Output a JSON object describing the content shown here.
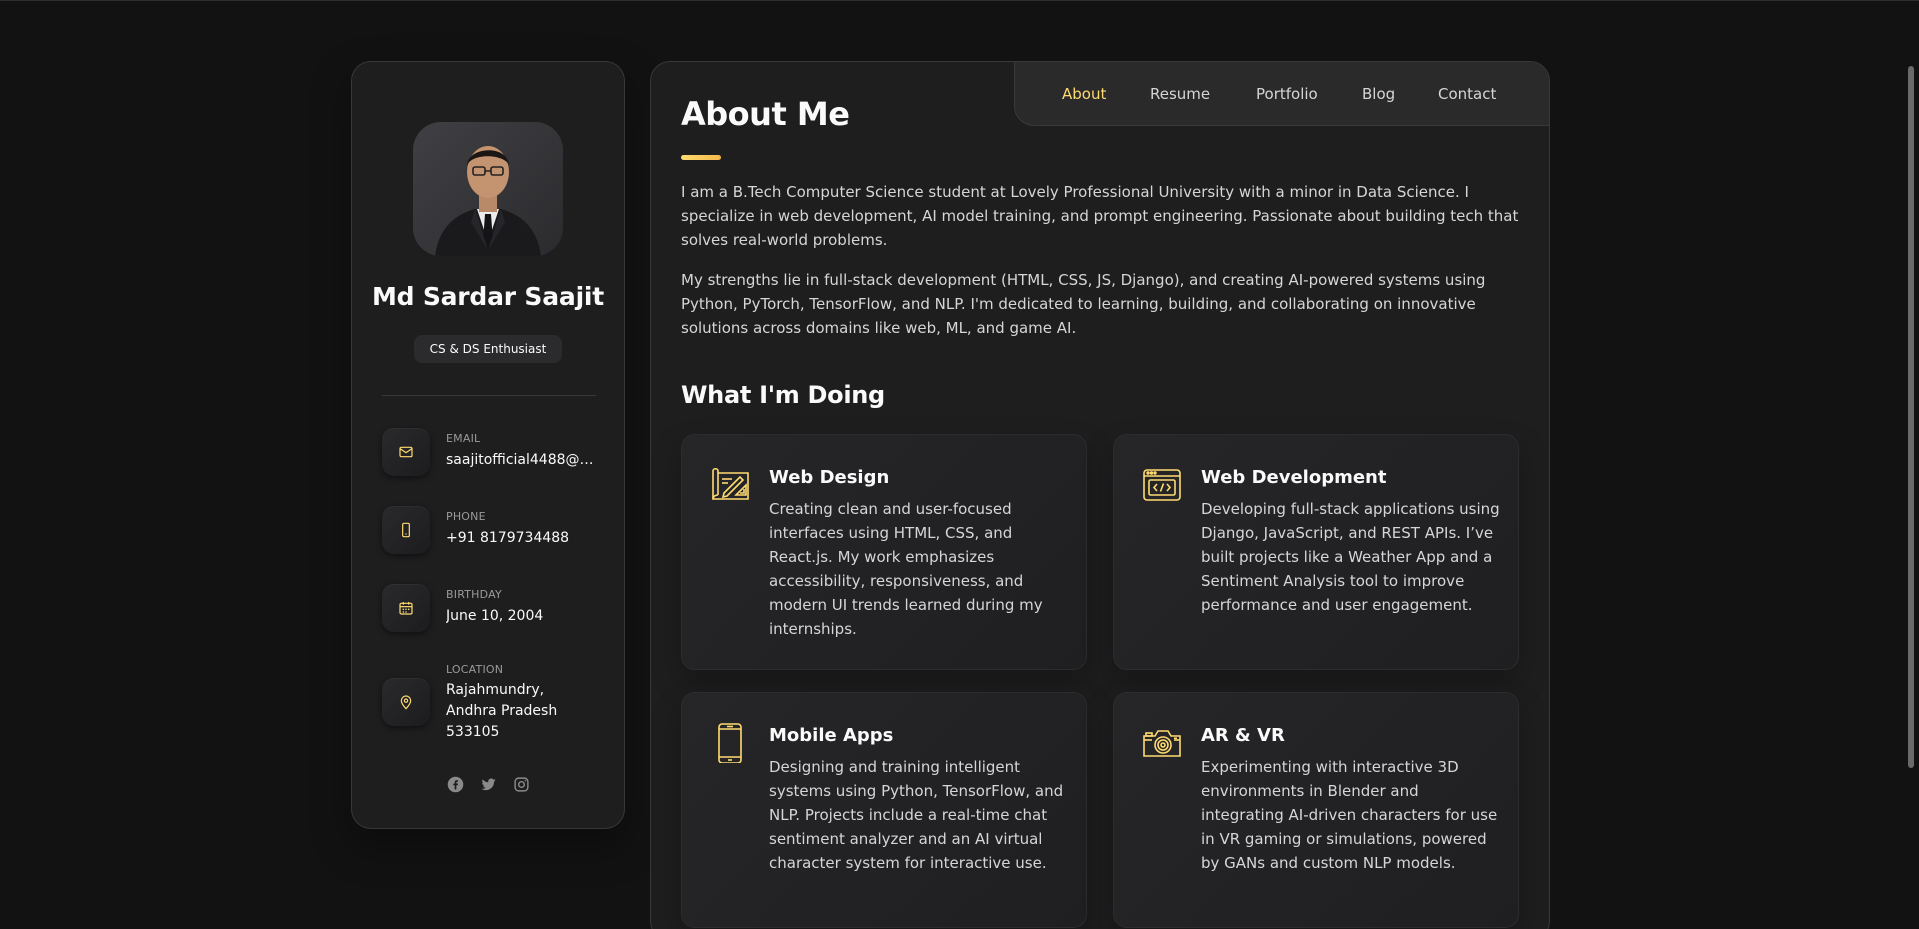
{
  "sidebar": {
    "name": "Md Sardar Saajit",
    "title": "CS & DS Enthusiast",
    "contacts": [
      {
        "label": "EMAIL",
        "value": "saajitofficial4488@g...",
        "icon": "mail-icon"
      },
      {
        "label": "PHONE",
        "value": "+91 8179734488",
        "icon": "phone-icon"
      },
      {
        "label": "BIRTHDAY",
        "value": "June 10, 2004",
        "icon": "calendar-icon"
      },
      {
        "label": "LOCATION",
        "value": "Rajahmundry, Andhra Pradesh 533105",
        "icon": "location-icon"
      }
    ],
    "socials": [
      "facebook-icon",
      "twitter-icon",
      "instagram-icon"
    ]
  },
  "navbar": {
    "items": [
      "About",
      "Resume",
      "Portfolio",
      "Blog",
      "Contact"
    ],
    "active": "About"
  },
  "about": {
    "heading": "About Me",
    "paragraphs": [
      "I am a B.Tech Computer Science student at Lovely Professional University with a minor in Data Science. I specialize in web development, AI model training, and prompt engineering. Passionate about building tech that solves real-world problems.",
      "My strengths lie in full-stack development (HTML, CSS, JS, Django), and creating AI-powered systems using Python, PyTorch, TensorFlow, and NLP. I'm dedicated to learning, building, and collaborating on innovative solutions across domains like web, ML, and game AI."
    ]
  },
  "services": {
    "heading": "What I'm Doing",
    "items": [
      {
        "title": "Web Design",
        "icon": "design-icon",
        "text": "Creating clean and user-focused interfaces using HTML, CSS, and React.js. My work emphasizes accessibility, responsiveness, and modern UI trends learned during my internships."
      },
      {
        "title": "Web Development",
        "icon": "code-icon",
        "text": "Developing full-stack applications using Django, JavaScript, and REST APIs. I’ve built projects like a Weather App and a Sentiment Analysis tool to improve performance and user engagement."
      },
      {
        "title": "Mobile Apps",
        "icon": "mobile-icon",
        "text": "Designing and training intelligent systems using Python, TensorFlow, and NLP. Projects include a real-time chat sentiment analyzer and an AI virtual character system for interactive use."
      },
      {
        "title": "AR & VR",
        "icon": "camera-icon",
        "text": "Experimenting with interactive 3D environments in Blender and integrating AI-driven characters for use in VR gaming or simulations, powered by GANs and custom NLP models."
      }
    ]
  },
  "colors": {
    "accent": "#ffdb70",
    "background": "#121212",
    "panel": "#1e1e1f"
  }
}
